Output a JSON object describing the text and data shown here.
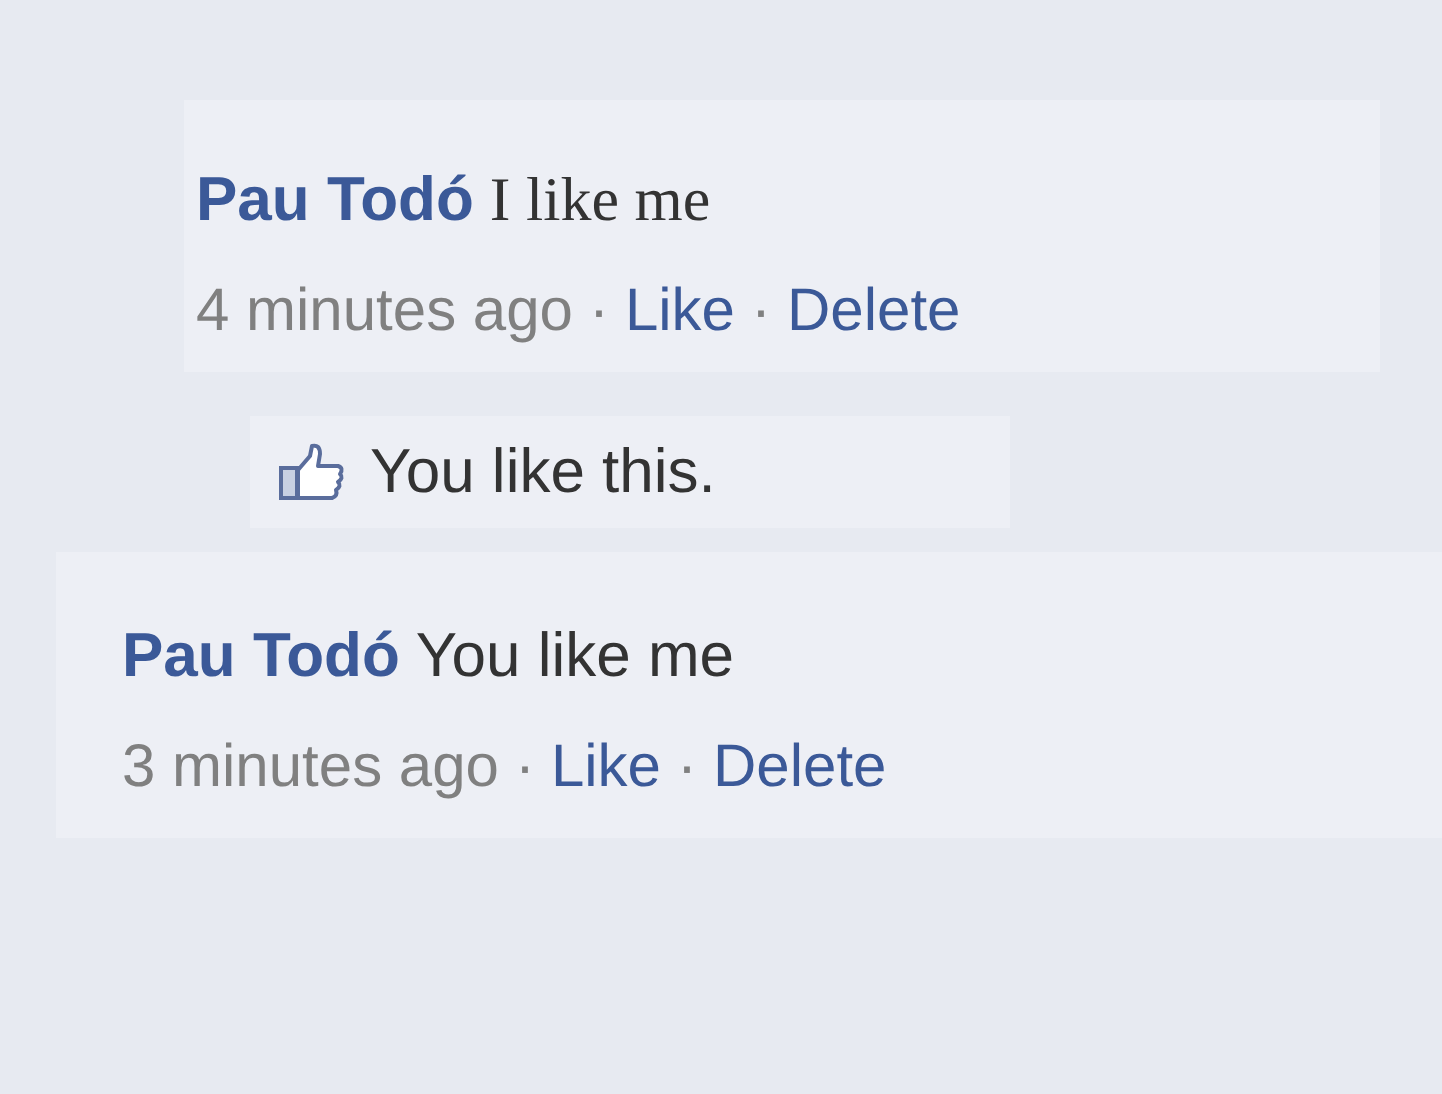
{
  "items": [
    {
      "kind": "comment",
      "author": "Pau Todó",
      "text": "I like me",
      "meta": [
        {
          "kind": "time",
          "text": "4 minutes ago"
        },
        {
          "kind": "separator",
          "text": "·"
        },
        {
          "kind": "link",
          "text": "Like"
        },
        {
          "kind": "separator",
          "text": "·"
        },
        {
          "kind": "link",
          "text": "Delete"
        }
      ]
    },
    {
      "kind": "likes",
      "text": "You like this."
    },
    {
      "kind": "comment",
      "author": "Pau Todó",
      "text": "You like me",
      "meta": [
        {
          "kind": "time",
          "text": "3 minutes ago"
        },
        {
          "kind": "separator",
          "text": "·"
        },
        {
          "kind": "link",
          "text": "Like"
        },
        {
          "kind": "separator",
          "text": "·"
        },
        {
          "kind": "link",
          "text": "Delete"
        }
      ]
    }
  ]
}
